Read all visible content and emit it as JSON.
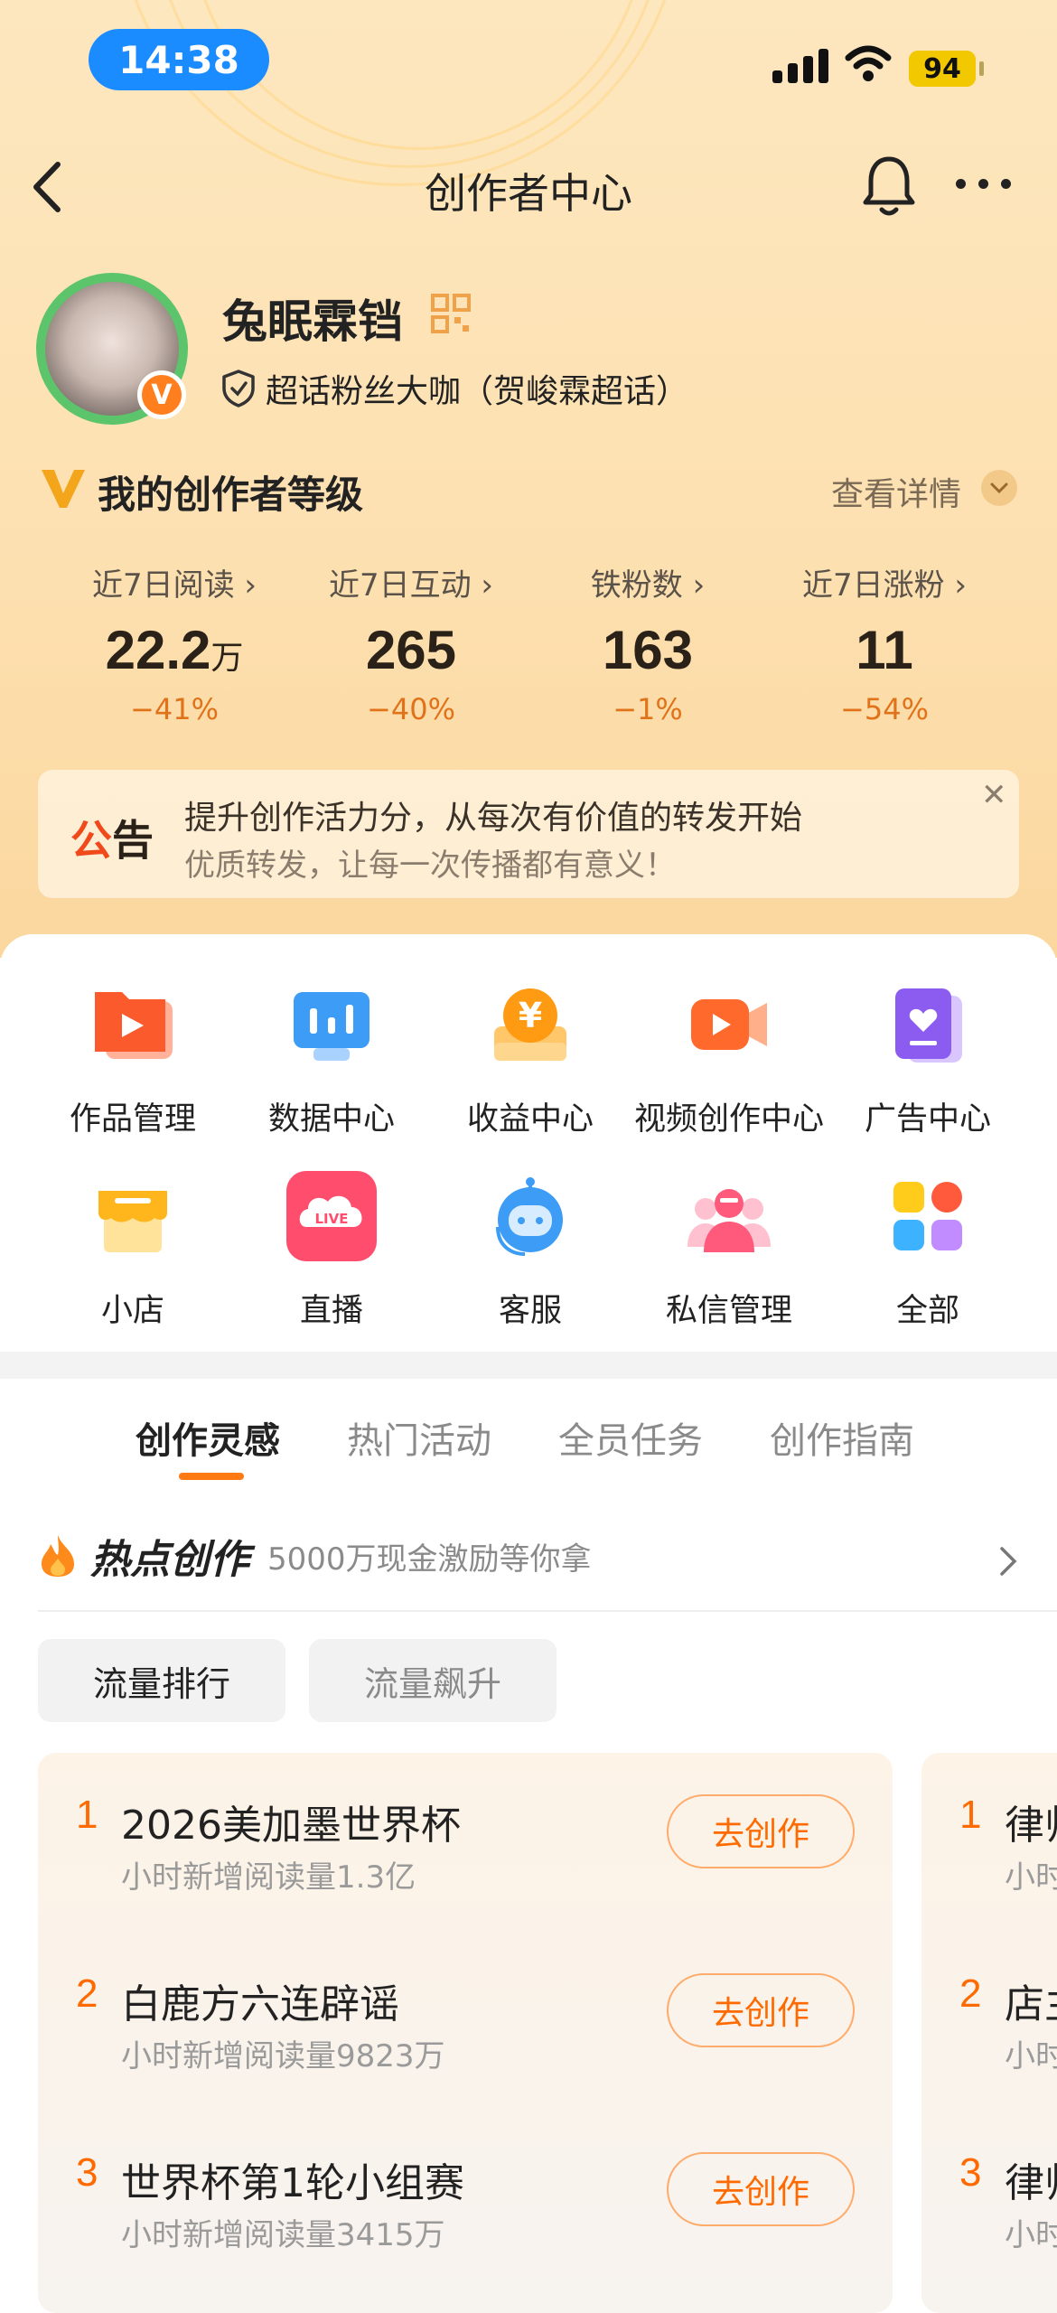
{
  "status_bar": {
    "time": "14:38",
    "battery": "94"
  },
  "nav": {
    "title": "创作者中心"
  },
  "profile": {
    "name": "兔眠霖铛",
    "tag": "超话粉丝大咖（贺峻霖超话）",
    "badge": "V"
  },
  "level": {
    "title": "我的创作者等级",
    "detail": "查看详情"
  },
  "stats": [
    {
      "label": "近7日阅读",
      "value": "22.2",
      "unit": "万",
      "change": "−41%"
    },
    {
      "label": "近7日互动",
      "value": "265",
      "unit": "",
      "change": "−40%"
    },
    {
      "label": "铁粉数",
      "value": "163",
      "unit": "",
      "change": "−1%"
    },
    {
      "label": "近7日涨粉",
      "value": "11",
      "unit": "",
      "change": "−54%"
    }
  ],
  "notice": {
    "tag_a": "公",
    "tag_b": "告",
    "line1": "提升创作活力分，从每次有价值的转发开始",
    "line2": "优质转发，让每一次传播都有意义！"
  },
  "grid": [
    {
      "label": "作品管理",
      "icon": "works-icon"
    },
    {
      "label": "数据中心",
      "icon": "data-icon"
    },
    {
      "label": "收益中心",
      "icon": "income-icon"
    },
    {
      "label": "视频创作中心",
      "icon": "video-icon"
    },
    {
      "label": "广告中心",
      "icon": "ad-icon"
    },
    {
      "label": "小店",
      "icon": "shop-icon"
    },
    {
      "label": "直播",
      "icon": "live-icon"
    },
    {
      "label": "客服",
      "icon": "service-icon"
    },
    {
      "label": "私信管理",
      "icon": "message-icon"
    },
    {
      "label": "全部",
      "icon": "all-icon"
    }
  ],
  "live_badge": "LIVE",
  "tabs": [
    "创作灵感",
    "热门活动",
    "全员任务",
    "创作指南"
  ],
  "hot": {
    "title": "热点创作",
    "subtitle": "5000万现金激励等你拿"
  },
  "filters": [
    "流量排行",
    "流量飙升"
  ],
  "trending": [
    {
      "rank": "1",
      "title": "2026美加墨世界杯",
      "sub": "小时新增阅读量1.3亿",
      "action": "去创作"
    },
    {
      "rank": "2",
      "title": "白鹿方六连辟谣",
      "sub": "小时新增阅读量9823万",
      "action": "去创作"
    },
    {
      "rank": "3",
      "title": "世界杯第1轮小组赛",
      "sub": "小时新增阅读量3415万",
      "action": "去创作"
    }
  ],
  "trending2": [
    {
      "rank": "1",
      "title": "律师",
      "sub": "小时"
    },
    {
      "rank": "2",
      "title": "店主",
      "sub": "小时"
    },
    {
      "rank": "3",
      "title": "律师",
      "sub": "小时"
    }
  ]
}
